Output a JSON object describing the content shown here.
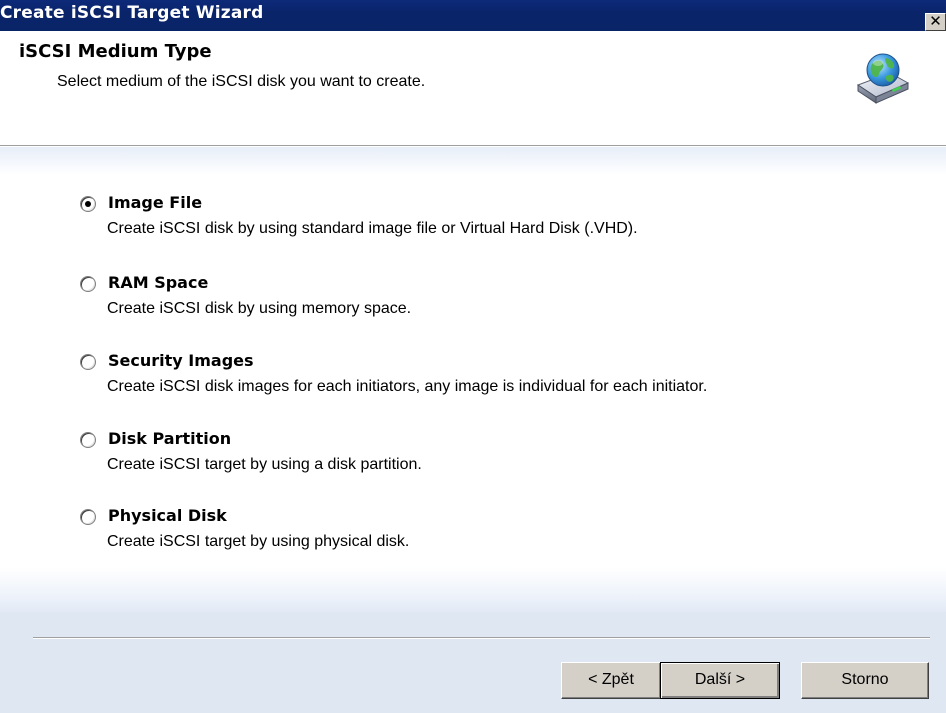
{
  "window": {
    "title": "Create iSCSI Target Wizard",
    "close_label": "✕"
  },
  "header": {
    "title": "iSCSI Medium Type",
    "subtitle": "Select medium of the iSCSI disk you want to create.",
    "icon": "globe-disk-icon"
  },
  "options": [
    {
      "label": "Image File",
      "description": "Create iSCSI disk by using standard image file or Virtual Hard Disk (.VHD).",
      "selected": true
    },
    {
      "label": "RAM Space",
      "description": "Create iSCSI disk by using memory space.",
      "selected": false
    },
    {
      "label": "Security Images",
      "description": "Create iSCSI disk images for each initiators, any image is individual for each initiator.",
      "selected": false
    },
    {
      "label": "Disk Partition",
      "description": "Create iSCSI target by using a disk partition.",
      "selected": false
    },
    {
      "label": "Physical Disk",
      "description": "Create iSCSI target by using physical disk.",
      "selected": false
    }
  ],
  "buttons": {
    "back": "< Zpět",
    "next": "Další >",
    "cancel": "Storno"
  },
  "colors": {
    "titlebar": "#0a246a",
    "button_face": "#d4d0c8",
    "content_tint": "#e7eef8"
  }
}
